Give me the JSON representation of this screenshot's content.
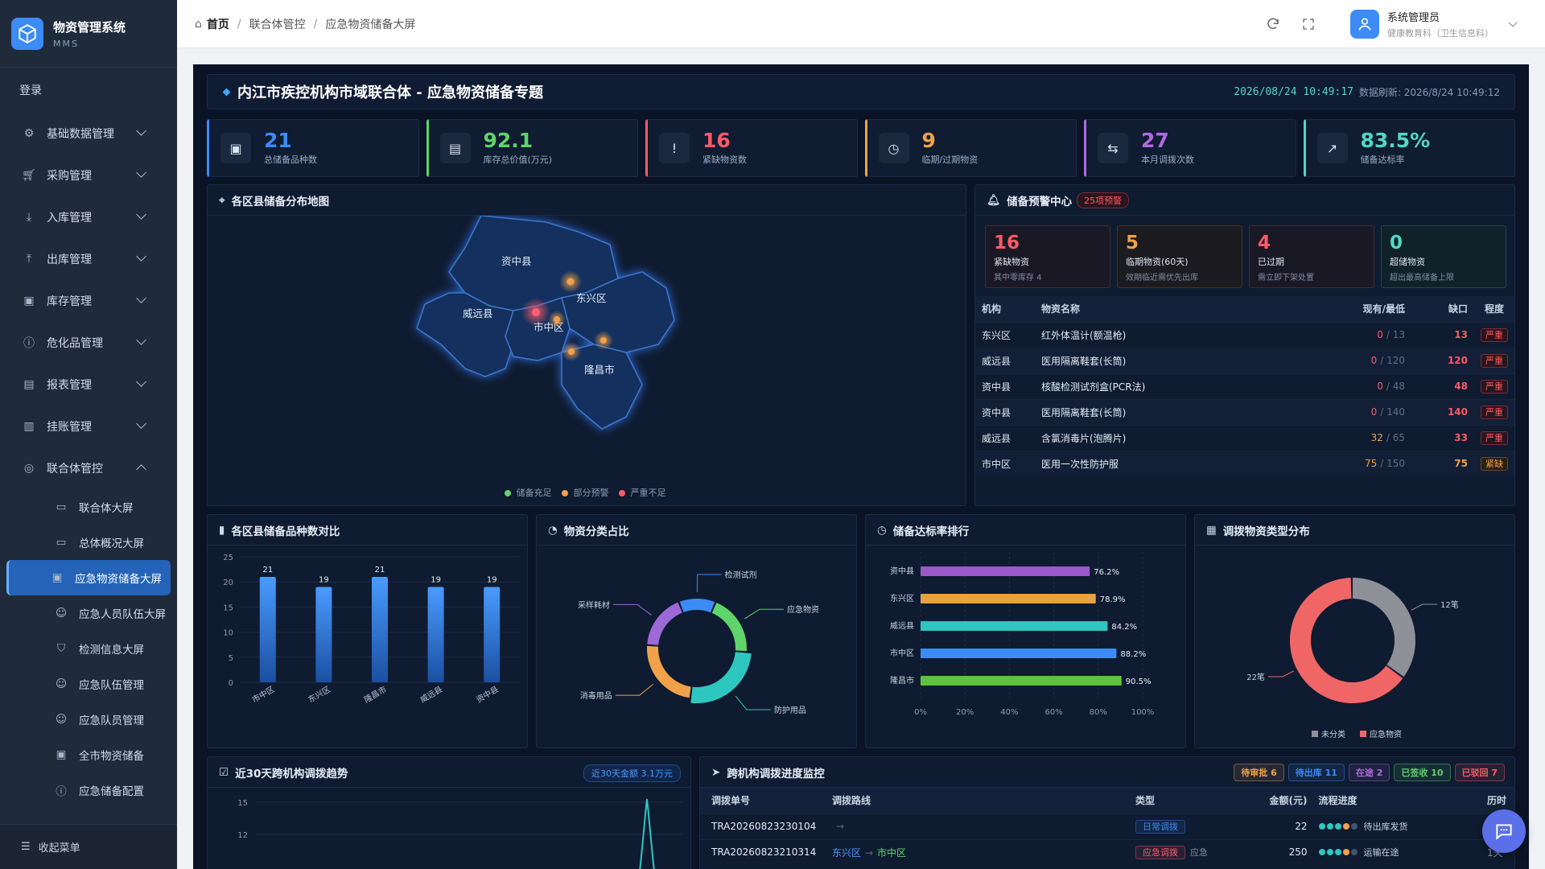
{
  "app": {
    "name": "物资管理系统",
    "short": "MMS",
    "logout": "登录",
    "collapse": "收起菜单"
  },
  "menu": [
    {
      "label": "基础数据管理",
      "icon": "gear-icon"
    },
    {
      "label": "采购管理",
      "icon": "cart-icon"
    },
    {
      "label": "入库管理",
      "icon": "download-icon"
    },
    {
      "label": "出库管理",
      "icon": "upload-icon"
    },
    {
      "label": "库存管理",
      "icon": "box-icon"
    },
    {
      "label": "危化品管理",
      "icon": "warning-icon"
    },
    {
      "label": "报表管理",
      "icon": "report-icon"
    },
    {
      "label": "挂账管理",
      "icon": "ledger-icon"
    },
    {
      "label": "联合体管控",
      "icon": "group-icon"
    }
  ],
  "submenu": [
    {
      "label": "联合体大屏",
      "icon": "monitor-icon"
    },
    {
      "label": "总体概况大屏",
      "icon": "monitor-icon"
    },
    {
      "label": "应急物资储备大屏",
      "icon": "box-icon"
    },
    {
      "label": "应急人员队伍大屏",
      "icon": "user-icon"
    },
    {
      "label": "检测信息大屏",
      "icon": "flask-icon"
    },
    {
      "label": "应急队伍管理",
      "icon": "user-icon"
    },
    {
      "label": "应急队员管理",
      "icon": "user-icon"
    },
    {
      "label": "全市物资储备",
      "icon": "box-icon"
    },
    {
      "label": "应急储备配置",
      "icon": "info-icon"
    }
  ],
  "breadcrumb": {
    "home": "首页",
    "level1": "联合体管控",
    "level2": "应急物资储备大屏"
  },
  "user": {
    "name": "系统管理员",
    "org": "健康教育科（卫生信息科）"
  },
  "screen": {
    "title": "内江市疾控机构市域联合体 - 应急物资储备专题",
    "clock": "2026/08/24 10:49:17",
    "refresh": "数据刷新: 2026/8/24 10:49:12"
  },
  "kpis": [
    {
      "value": "21",
      "label": "总储备品种数",
      "color": "#3d8bf6",
      "icon": "package-icon"
    },
    {
      "value": "92.1",
      "label": "库存总价值(万元)",
      "color": "#5fd46a",
      "icon": "money-icon"
    },
    {
      "value": "16",
      "label": "紧缺物资数",
      "color": "#ff5a66",
      "icon": "alert-icon"
    },
    {
      "value": "9",
      "label": "临期/过期物资",
      "color": "#f0a24a",
      "icon": "clock-icon"
    },
    {
      "value": "27",
      "label": "本月调拨次数",
      "color": "#b06ae0",
      "icon": "transfer-icon"
    },
    {
      "value": "83.5%",
      "label": "储备达标率",
      "color": "#4fd8c6",
      "icon": "trend-icon"
    }
  ],
  "map": {
    "title": "各区县储备分布地图",
    "districts": [
      "资中县",
      "东兴区",
      "威远县",
      "市中区",
      "隆昌市"
    ],
    "legend": [
      {
        "label": "储备充足",
        "color": "#5fd46a"
      },
      {
        "label": "部分预警",
        "color": "#f0a24a"
      },
      {
        "label": "严重不足",
        "color": "#ff5a66"
      }
    ]
  },
  "alerts": {
    "title": "储备预警中心",
    "badge": "25项预警",
    "cards": [
      {
        "value": "16",
        "label": "紧缺物资",
        "sub": "其中零库存 4",
        "color": "#ff5a66"
      },
      {
        "value": "5",
        "label": "临期物资(60天)",
        "sub": "效期临近需优先出库",
        "color": "#f0a24a"
      },
      {
        "value": "4",
        "label": "已过期",
        "sub": "需立即下架处置",
        "color": "#ff5a66"
      },
      {
        "value": "0",
        "label": "超储物资",
        "sub": "超出最高储备上限",
        "color": "#4fd8c6"
      }
    ],
    "headers": [
      "机构",
      "物资名称",
      "现有/最低",
      "缺口",
      "程度"
    ],
    "rows": [
      {
        "org": "东兴区",
        "item": "红外体温计(额温枪)",
        "cur": "0",
        "min": "/ 13",
        "gap": "13",
        "level": "严重"
      },
      {
        "org": "威远县",
        "item": "医用隔离鞋套(长筒)",
        "cur": "0",
        "min": "/ 120",
        "gap": "120",
        "level": "严重"
      },
      {
        "org": "资中县",
        "item": "核酸检测试剂盒(PCR法)",
        "cur": "0",
        "min": "/ 48",
        "gap": "48",
        "level": "严重"
      },
      {
        "org": "资中县",
        "item": "医用隔离鞋套(长筒)",
        "cur": "0",
        "min": "/ 140",
        "gap": "140",
        "level": "严重"
      },
      {
        "org": "威远县",
        "item": "含氯消毒片(泡腾片)",
        "cur": "32",
        "min": "/ 65",
        "gap": "33",
        "level": "严重"
      },
      {
        "org": "市中区",
        "item": "医用一次性防护服",
        "cur": "75",
        "min": "/ 150",
        "gap": "75",
        "level": "紧缺"
      }
    ]
  },
  "bar_title": "各区县储备品种数对比",
  "donut_title": "物资分类占比",
  "rank_title": "储备达标率排行",
  "pie_title": "调拨物资类型分布",
  "trend_title": "近30天跨机构调拨趋势",
  "trend_badge": "近30天金额 3.1万元",
  "monitor": {
    "title": "跨机构调拨进度监控",
    "tags": [
      {
        "label": "待审批 6",
        "color": "#f0a24a"
      },
      {
        "label": "待出库 11",
        "color": "#3d8bf6"
      },
      {
        "label": "在途 2",
        "color": "#b06ae0"
      },
      {
        "label": "已签收 10",
        "color": "#5fd46a"
      },
      {
        "label": "已驳回 7",
        "color": "#ff5a66"
      }
    ],
    "headers": [
      "调拨单号",
      "调拨路线",
      "类型",
      "金额(元)",
      "流程进度",
      "历时"
    ],
    "rows": [
      {
        "no": "TRA20260823230104",
        "from": "",
        "to": "",
        "type": "日常调拨",
        "type_color": "#3d8bf6",
        "amount": "22",
        "stage": "待出库发货",
        "dur": ""
      },
      {
        "no": "TRA20260823210314",
        "from": "东兴区",
        "to": "市中区",
        "type": "应急调拨",
        "type_color": "#ff5a66",
        "amount": "250",
        "stage": "运输在途",
        "dur": "1天",
        "type_note": "应急"
      }
    ]
  },
  "chart_data": [
    {
      "type": "bar",
      "title": "各区县储备品种数对比",
      "categories": [
        "市中区",
        "东兴区",
        "隆昌市",
        "威远县",
        "资中县"
      ],
      "values": [
        21,
        19,
        21,
        19,
        19
      ],
      "ylim": [
        0,
        25
      ],
      "yticks": [
        0,
        5,
        10,
        15,
        20,
        25
      ]
    },
    {
      "type": "pie",
      "title": "物资分类占比",
      "labels": [
        "检测试剂",
        "应急物资",
        "防护用品",
        "消毒用品",
        "采样耗材"
      ],
      "values": [
        12,
        20,
        26,
        24,
        18
      ],
      "colors": [
        "#3d8bf6",
        "#5fd46a",
        "#2ec7c0",
        "#f0a24a",
        "#9b6ad6"
      ]
    },
    {
      "type": "bar",
      "title": "储备达标率排行",
      "orientation": "horizontal",
      "categories": [
        "资中县",
        "东兴区",
        "威远县",
        "市中区",
        "隆昌市"
      ],
      "values": [
        76.2,
        78.9,
        84.2,
        88.2,
        90.5
      ],
      "labels": [
        "76.2%",
        "78.9%",
        "84.2%",
        "88.2%",
        "90.5%"
      ],
      "colors": [
        "#9b59c9",
        "#e8a33d",
        "#2ec7c0",
        "#3d8bf6",
        "#5fc43d"
      ],
      "xlim": [
        0,
        100
      ],
      "xticks": [
        "0%",
        "20%",
        "40%",
        "60%",
        "80%",
        "100%"
      ]
    },
    {
      "type": "pie",
      "title": "调拨物资类型分布",
      "labels": [
        "未分类",
        "应急物资"
      ],
      "values": [
        12,
        22
      ],
      "slice_labels": [
        "12笔",
        "22笔"
      ],
      "colors": [
        "#8e9198",
        "#f06666"
      ]
    },
    {
      "type": "line",
      "title": "近30天跨机构调拨趋势",
      "yticks": [
        12,
        15
      ]
    }
  ]
}
